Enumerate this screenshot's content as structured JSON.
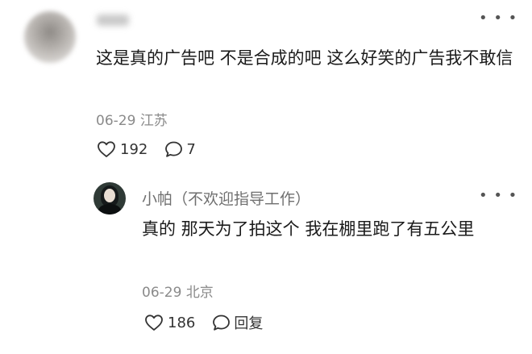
{
  "top_comment": {
    "text": "这是真的广告吧 不是合成的吧 这么好笑的广告我不敢信",
    "date": "06-29",
    "location": "江苏",
    "likes": "192",
    "replies": "7",
    "more_icon": "more-dots-icon"
  },
  "reply": {
    "username": "小帕（不欢迎指导工作）",
    "text": "真的 那天为了拍这个 我在棚里跑了有五公里",
    "date": "06-29",
    "location": "北京",
    "likes": "186",
    "reply_label": "回复",
    "more_icon": "more-dots-icon"
  },
  "icons": {
    "like": "heart-outline-icon",
    "comment": "speech-bubble-icon"
  }
}
